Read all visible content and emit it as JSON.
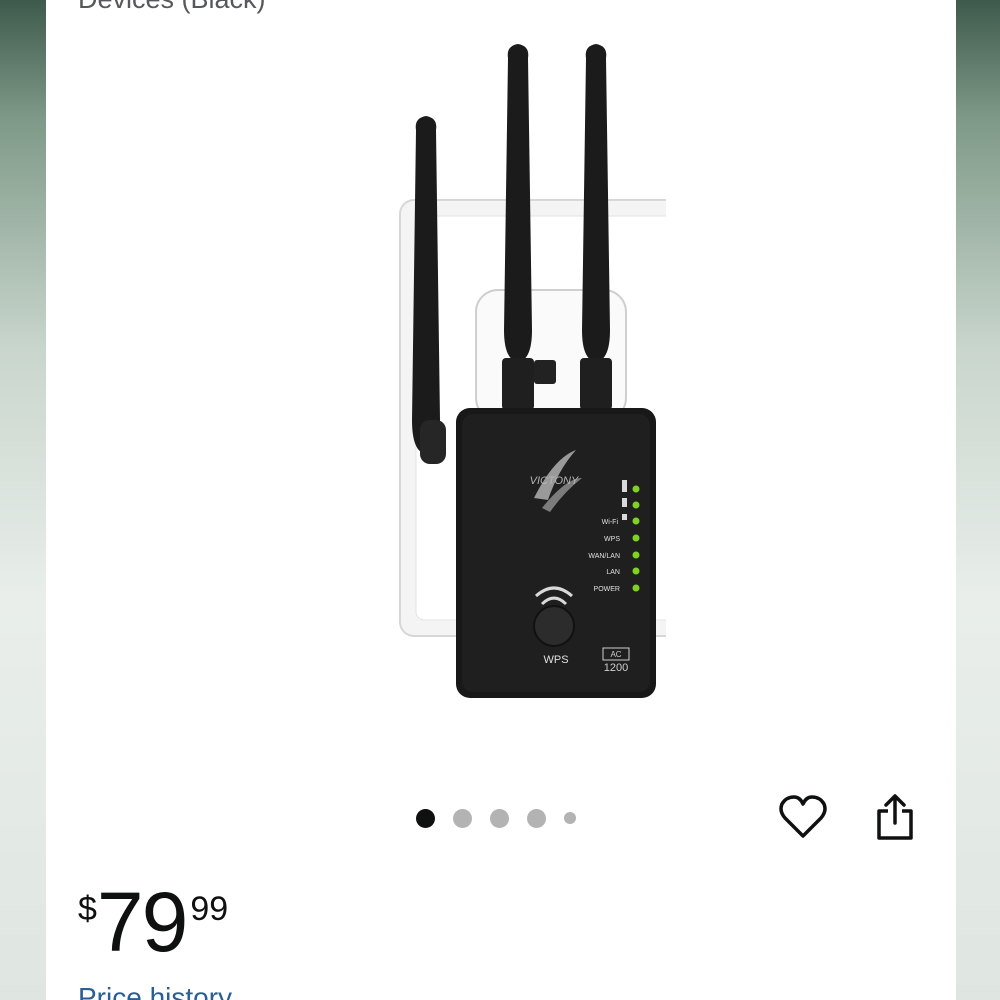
{
  "product": {
    "title": "Devices (Black)",
    "brand_logo_text": "VICTONY",
    "device_labels": {
      "leds": [
        "Wi-Fi",
        "WPS",
        "WAN/LAN",
        "LAN",
        "POWER"
      ],
      "button": "WPS",
      "badge_top": "AC",
      "badge_bottom": "1200"
    }
  },
  "carousel": {
    "total_dots": 5,
    "active_index": 0
  },
  "actions": {
    "wishlist_icon": "heart-icon",
    "share_icon": "share-icon"
  },
  "price": {
    "symbol": "$",
    "whole": "79",
    "fraction": "99"
  },
  "links": {
    "price_history": "Price history"
  },
  "colors": {
    "link": "#2a5e96",
    "text": "#0f1111",
    "led": "#7ed321"
  }
}
